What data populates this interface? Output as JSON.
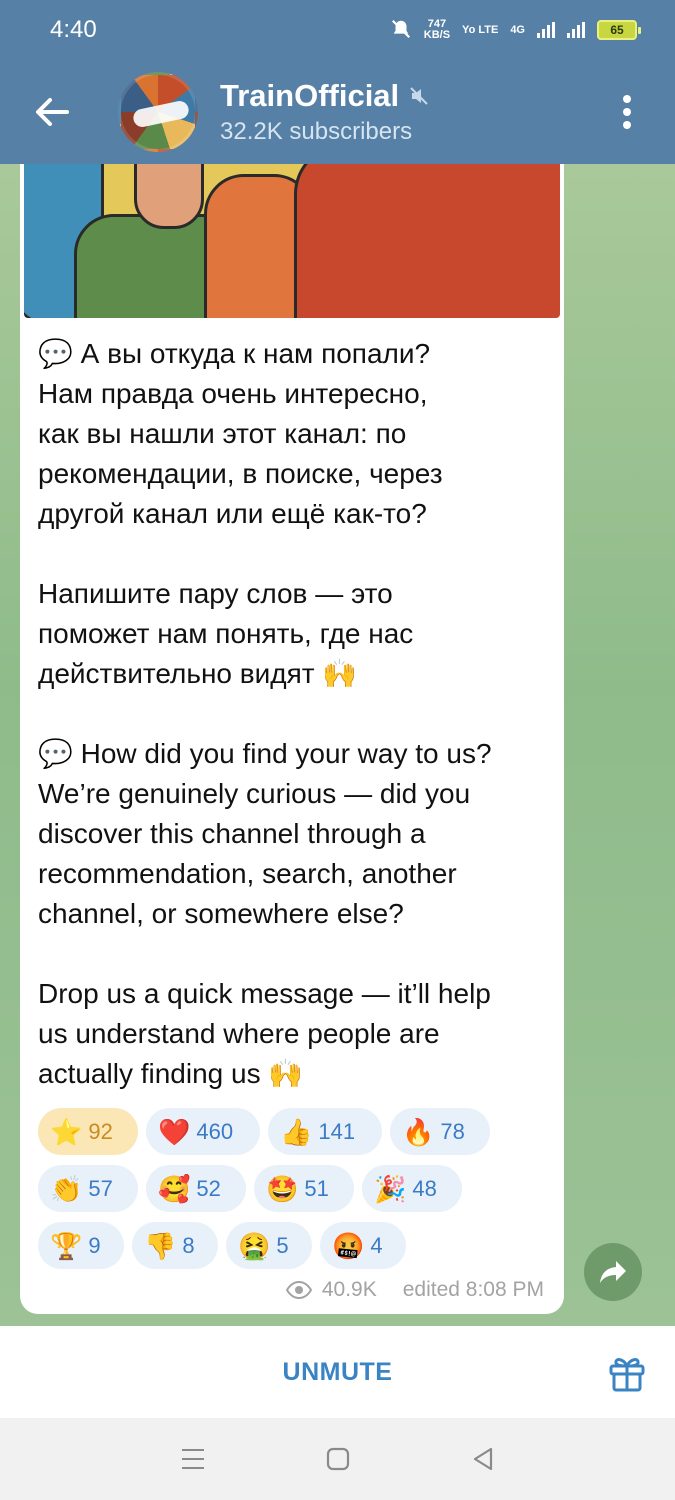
{
  "status_bar": {
    "time": "4:40",
    "net_speed_value": "747",
    "net_speed_unit": "KB/S",
    "volte": "Yo LTE",
    "network": "4G",
    "battery": "65"
  },
  "header": {
    "channel_name": "TrainOfficial",
    "subscribers": "32.2K subscribers"
  },
  "message": {
    "text": "💬 А вы откуда к нам попали?\nНам правда очень интересно,\nкак вы нашли этот канал: по\nрекомендации, в поиске, через\nдругой канал или ещё как-то?\n\nНапишите пару слов — это\nпоможет нам понять, где нас\nдействительно видят 🙌\n\n💬 How did you find your way to us?\nWe’re genuinely curious — did you\ndiscover this channel through a\nrecommendation, search, another\nchannel, or somewhere else?\n\nDrop us a quick message — it’ll help\nus understand where people are\nactually finding us 🙌",
    "views": "40.9K",
    "edited": "edited 8:08 PM"
  },
  "reactions": [
    [
      {
        "emoji": "⭐",
        "count": "92",
        "active": true
      },
      {
        "emoji": "❤️",
        "count": "460"
      },
      {
        "emoji": "👍",
        "count": "141"
      },
      {
        "emoji": "🔥",
        "count": "78"
      }
    ],
    [
      {
        "emoji": "👏",
        "count": "57"
      },
      {
        "emoji": "🥰",
        "count": "52"
      },
      {
        "emoji": "🤩",
        "count": "51"
      },
      {
        "emoji": "🎉",
        "count": "48"
      }
    ],
    [
      {
        "emoji": "🏆",
        "count": "9"
      },
      {
        "emoji": "👎",
        "count": "8"
      },
      {
        "emoji": "🤮",
        "count": "5"
      },
      {
        "emoji": "🤬",
        "count": "4"
      }
    ]
  ],
  "bottom": {
    "unmute_label": "UNMUTE"
  },
  "icons": {
    "back": "arrow-left-icon",
    "muted": "speaker-muted-icon",
    "more": "more-vertical-icon",
    "views": "eye-icon",
    "share": "share-arrow-icon",
    "gift": "gift-icon"
  },
  "colors": {
    "header": "#5680a6",
    "accent": "#3a84c4",
    "chat_bg": "#8fbb8a"
  }
}
